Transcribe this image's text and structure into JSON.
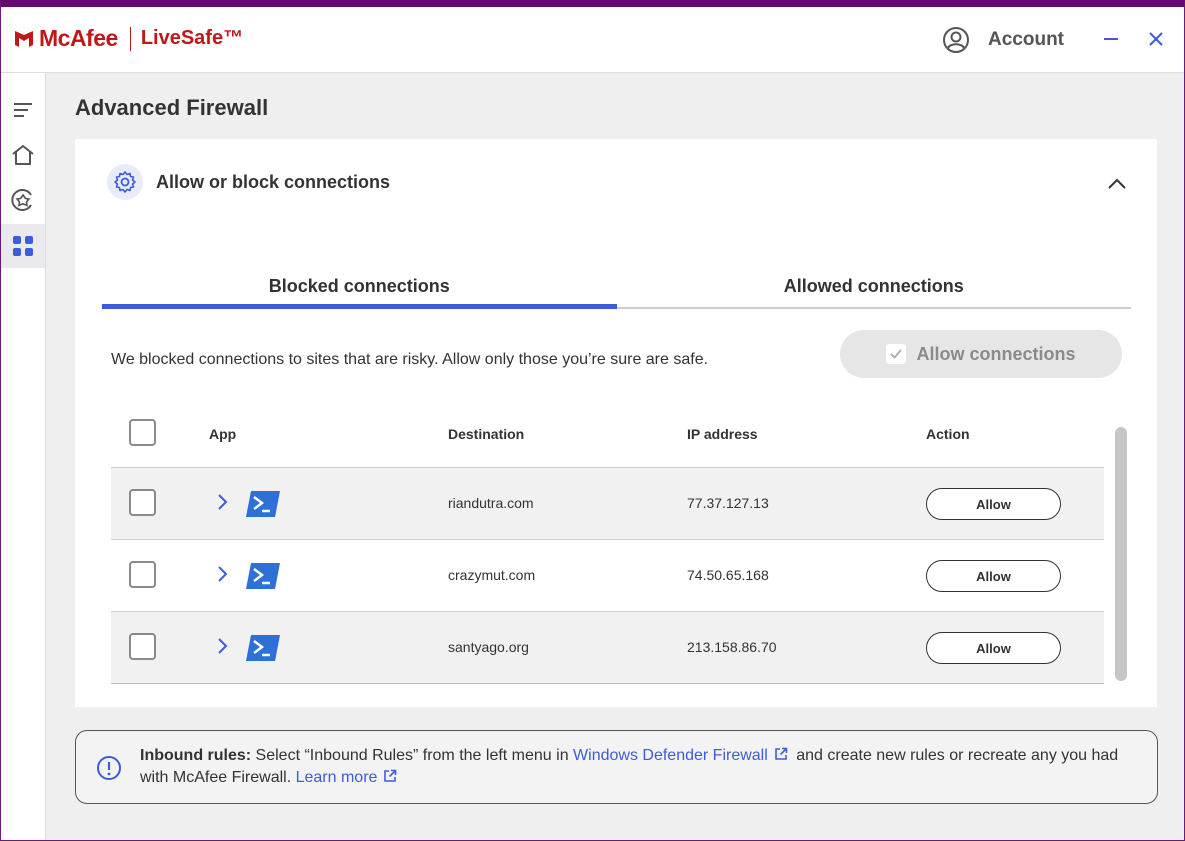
{
  "header": {
    "brand": "McAfee",
    "product": "LiveSafe™",
    "account_label": "Account"
  },
  "sidebar": {
    "items": [
      {
        "icon": "menu-icon"
      },
      {
        "icon": "home-icon"
      },
      {
        "icon": "protection-icon"
      },
      {
        "icon": "apps-grid-icon",
        "active": true
      }
    ]
  },
  "page": {
    "title": "Advanced Firewall"
  },
  "card": {
    "title": "Allow or block connections",
    "tabs": [
      {
        "label": "Blocked connections",
        "active": true
      },
      {
        "label": "Allowed connections",
        "active": false
      }
    ],
    "description": "We blocked connections to sites that are risky. Allow only those you’re sure are safe.",
    "allow_connections_label": "Allow connections"
  },
  "table": {
    "columns": [
      "App",
      "Destination",
      "IP address",
      "Action"
    ],
    "rows": [
      {
        "destination": "riandutra.com",
        "ip": "77.37.127.13",
        "action": "Allow"
      },
      {
        "destination": "crazymut.com",
        "ip": "74.50.65.168",
        "action": "Allow"
      },
      {
        "destination": "santyago.org",
        "ip": "213.158.86.70",
        "action": "Allow"
      }
    ]
  },
  "info": {
    "bold": "Inbound rules:",
    "text1": " Select “Inbound Rules” from the left menu in ",
    "link1": "Windows Defender Firewall",
    "text2": " and create new rules or recreate any you had with McAfee Firewall. ",
    "link2": "Learn more"
  },
  "colors": {
    "brand_red": "#c01818",
    "accent_blue": "#3c5cdc",
    "window_border": "#640a6e"
  }
}
